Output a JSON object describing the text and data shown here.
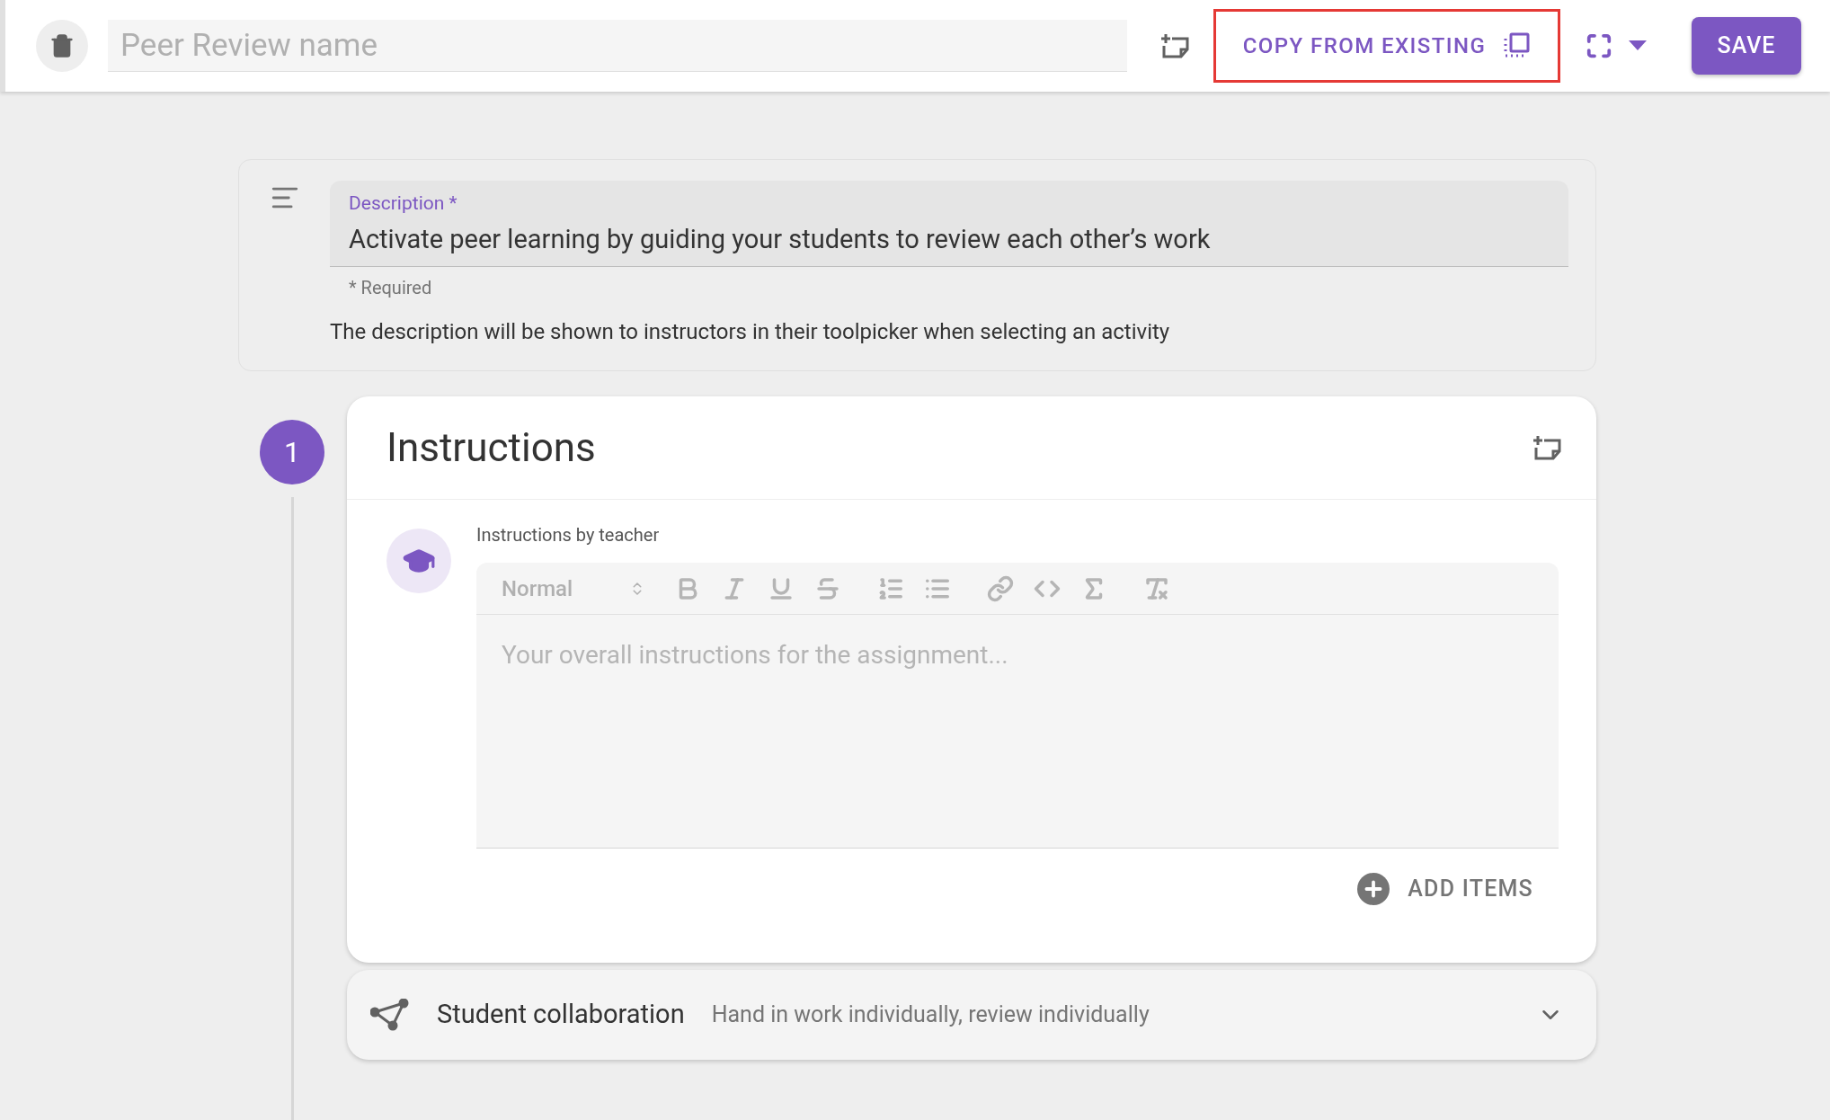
{
  "top_bar": {
    "name_field": {
      "placeholder": "Peer Review name"
    },
    "copy_button": {
      "label": "COPY FROM EXISTING",
      "highlighted": true
    },
    "save_button": {
      "label": "SAVE"
    }
  },
  "description": {
    "label": "Description *",
    "value": "Activate peer learning by guiding your students to review each other’s work",
    "required_note": "* Required",
    "helper": "The description will be shown to instructors in their toolpicker when selecting an activity"
  },
  "steps": [
    {
      "number": "1",
      "title": "Instructions",
      "editor_label": "Instructions by teacher",
      "format_select": "Normal",
      "editor": {
        "placeholder": "Your overall instructions for the assignment..."
      },
      "add_items": "ADD ITEMS"
    }
  ],
  "collaboration": {
    "title": "Student collaboration",
    "summary": "Hand in work individually, review individually",
    "expanded": false
  }
}
